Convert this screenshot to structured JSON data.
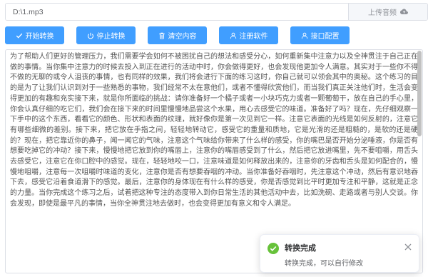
{
  "file": {
    "path_value": "D:\\1.mp3",
    "upload_label": "上传音频"
  },
  "toolbar": {
    "start_label": "开始转换",
    "stop_label": "停止转换",
    "clear_label": "清空内容",
    "register_label": "注册软件",
    "config_label": "接口配置"
  },
  "content": {
    "text": "为了帮助人们更好的管理压力，我们需要学会如何不被困扰自己的想法和感受分心，如何重新集中注意力以及全神贯注于自己正在做的事情。当你集中注意力的时候去投入到正在进行的活动中时，你会做得更好，也会发现他更加令人满意。其实对于一些你不得不做的无聊的或令人沮丧的事情，也有同样的效果，我们将会进行下面的练习这时，你自己就可以领会其中的奥秘。这个练习的目的是为了让我们认识到对于一些熟悉的事物，我们经常不太在意他们，或者不懂得欣赏他们，而当我们真正关注他们时，生活会变得更加的有趣和充实接下来，就是你所面临的挑战：请你准备好一个橘子或者一小块巧克力或者一颗葡萄干，放在自己的手心里，你会认真仔细的吃它们，我们会在接下来的时间里慢慢地品尝这个水果，用心去感受它的味道。准备好了吗？现在，先仔细观察一下手中的这个东西，看看它的颜色、形状和表面的纹理，就好像你是第一次见到它一样。注意它表面的光线是如何反射的，注意它有哪些细微的差别。接下来，把它放在手指之间，轻轻地转动它，感受它的重量和质地，它是光滑的还是粗糙的，是软的还是硬的？现在，把它靠近你的鼻子，闻一闻它的气味，注意这个气味给你带来了什么样的感受，你的嘴巴是否开始分泌唾液，你是否有想要吃掉它的冲动？接下来，慢慢地把它放到你的嘴唇上，注意你的嘴唇感受到了什么，然后把它放进嘴里，先不要咀嚼，用舌头去感受它，注意它在你口腔中的感觉。现在，轻轻地咬一口，注意味道是如何释放出来的，注意你的牙齿和舌头是如何配合的，慢慢地咀嚼，注意每一次咀嚼时味道的变化，注意你是否有想要吞咽的冲动。当你准备好吞咽时，先注意这个冲动，然后有意识地吞下去，感受它沿着食道滑下的感觉。最后，注意你的身体现在有什么样的感受，你是否感觉到比平时更加专注和平静，这就是正念的力量。当你完成这个练习之后，试着把这种专注的态度带入到你日常生活的其他活动中去，比如洗碗、走路或者与别人交谈。你会发现，即使是最平凡的事情，当你全神贯注地去做时，也会变得更加有意义和令人满足。"
  },
  "toast": {
    "title": "转换完成",
    "message": "转换完成，可以自行修改"
  },
  "colors": {
    "primary": "#409eff",
    "success": "#67c23a"
  }
}
